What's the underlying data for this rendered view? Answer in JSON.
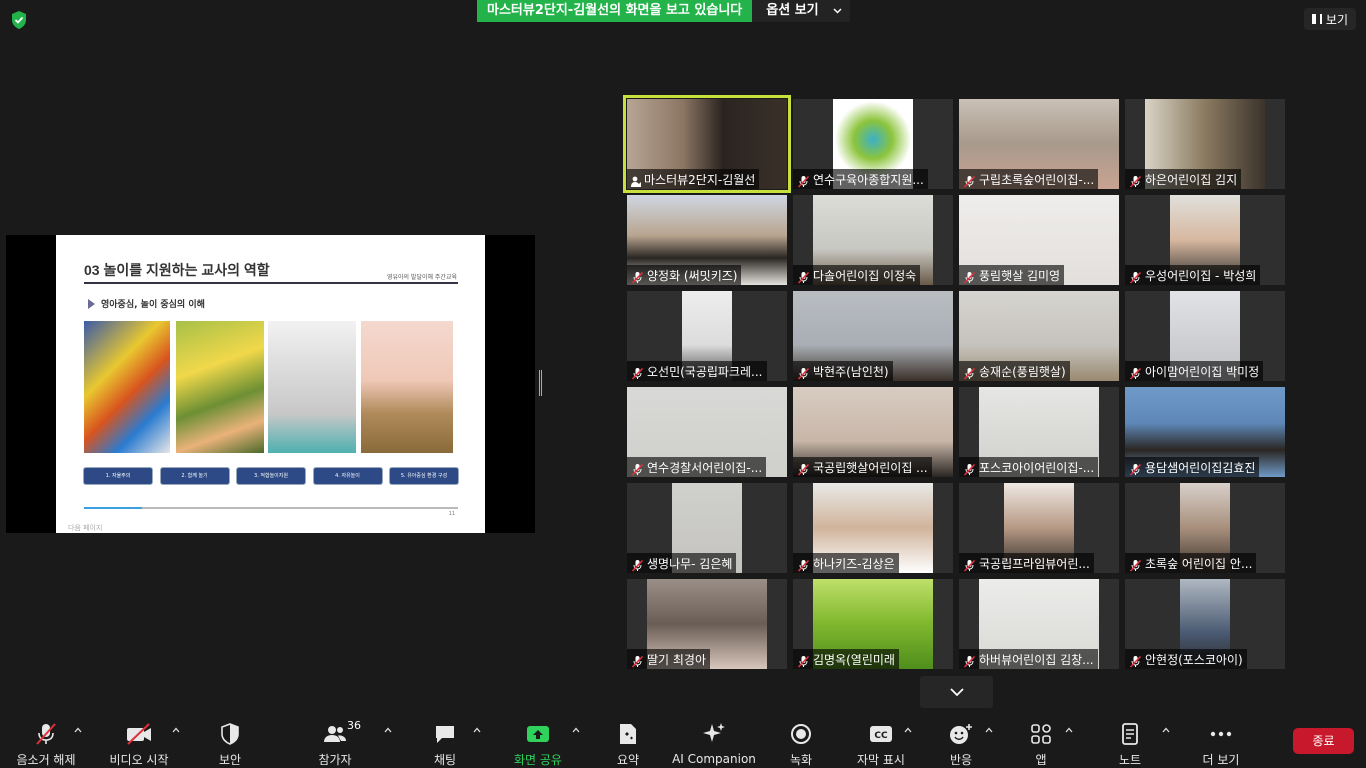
{
  "top": {
    "share_banner": "마스터뷰2단지-김월선의 화면을 보고 있습니다",
    "options_label": "옵션 보기",
    "view_label": "보기"
  },
  "slide": {
    "title": "03 놀이를 지원하는 교사의 역할",
    "subtitle": "영유아의 발달이해 주간교육",
    "heading": "영아중심, 놀이 중심의 이해",
    "tags": [
      "1. 자율주의",
      "2. 함께 놀기",
      "3. 적합놀이지원",
      "4. 자유놀이",
      "5. 유아중심 환경 구성"
    ],
    "page": "11",
    "footer": "다음 페이지"
  },
  "participants": [
    {
      "name": "마스터뷰2단지-김월선",
      "icon": "host-pin-icon"
    },
    {
      "name": "연수구육아종합지원...",
      "icon": "muted-mic-icon"
    },
    {
      "name": "구립초록숲어린이집-...",
      "icon": "muted-mic-icon"
    },
    {
      "name": "하은어린이집 김지",
      "icon": "muted-mic-icon"
    },
    {
      "name": "양정화 (써밋키즈)",
      "icon": "muted-mic-icon"
    },
    {
      "name": "다솔어린이집 이정숙",
      "icon": "muted-mic-icon"
    },
    {
      "name": "풍림햇살 김미영",
      "icon": "muted-mic-icon"
    },
    {
      "name": "우성어린이집 - 박성희",
      "icon": "muted-mic-icon"
    },
    {
      "name": "오선민(국공립파크레...",
      "icon": "muted-mic-icon"
    },
    {
      "name": "박현주(남인천)",
      "icon": "muted-mic-icon"
    },
    {
      "name": "송재순(풍림햇살)",
      "icon": "muted-mic-icon"
    },
    {
      "name": "아이맘어린이집 박미정",
      "icon": "muted-mic-icon"
    },
    {
      "name": "연수경찰서어린이집-...",
      "icon": "muted-mic-icon"
    },
    {
      "name": "국공립햇살어린이집 ...",
      "icon": "muted-mic-icon"
    },
    {
      "name": "포스코아이어린이집-...",
      "icon": "muted-mic-icon"
    },
    {
      "name": "용담샘어린이집김효진",
      "icon": "muted-mic-icon"
    },
    {
      "name": "생명나무- 김은혜",
      "icon": "muted-mic-icon"
    },
    {
      "name": "하나키즈-김상은",
      "icon": "muted-mic-icon"
    },
    {
      "name": "국공립프라임뷰어린...",
      "icon": "muted-mic-icon"
    },
    {
      "name": "초록숲 어린이집  안...",
      "icon": "muted-mic-icon"
    },
    {
      "name": "딸기 최경아",
      "icon": "muted-mic-icon"
    },
    {
      "name": "김명옥(열린미래",
      "icon": "muted-mic-icon"
    },
    {
      "name": "하버뷰어린이집 김창...",
      "icon": "muted-mic-icon"
    },
    {
      "name": "안현정(포스코아이)",
      "icon": "muted-mic-icon"
    }
  ],
  "toolbar": {
    "audio": "음소거 해제",
    "video": "비디오 시작",
    "security": "보안",
    "participants": "참가자",
    "participants_count": "36",
    "chat": "채팅",
    "share": "화면 공유",
    "summary": "요약",
    "ai": "AI Companion",
    "record": "녹화",
    "captions": "자막 표시",
    "captions_icon_text": "CC",
    "reactions": "반응",
    "apps": "앱",
    "notes": "노트",
    "more": "더 보기",
    "end": "종료"
  },
  "colors": {
    "banner_green": "#23b34a",
    "active_speaker": "#c7e03c",
    "end_red": "#c8182b",
    "share_green": "#2fd35c"
  }
}
